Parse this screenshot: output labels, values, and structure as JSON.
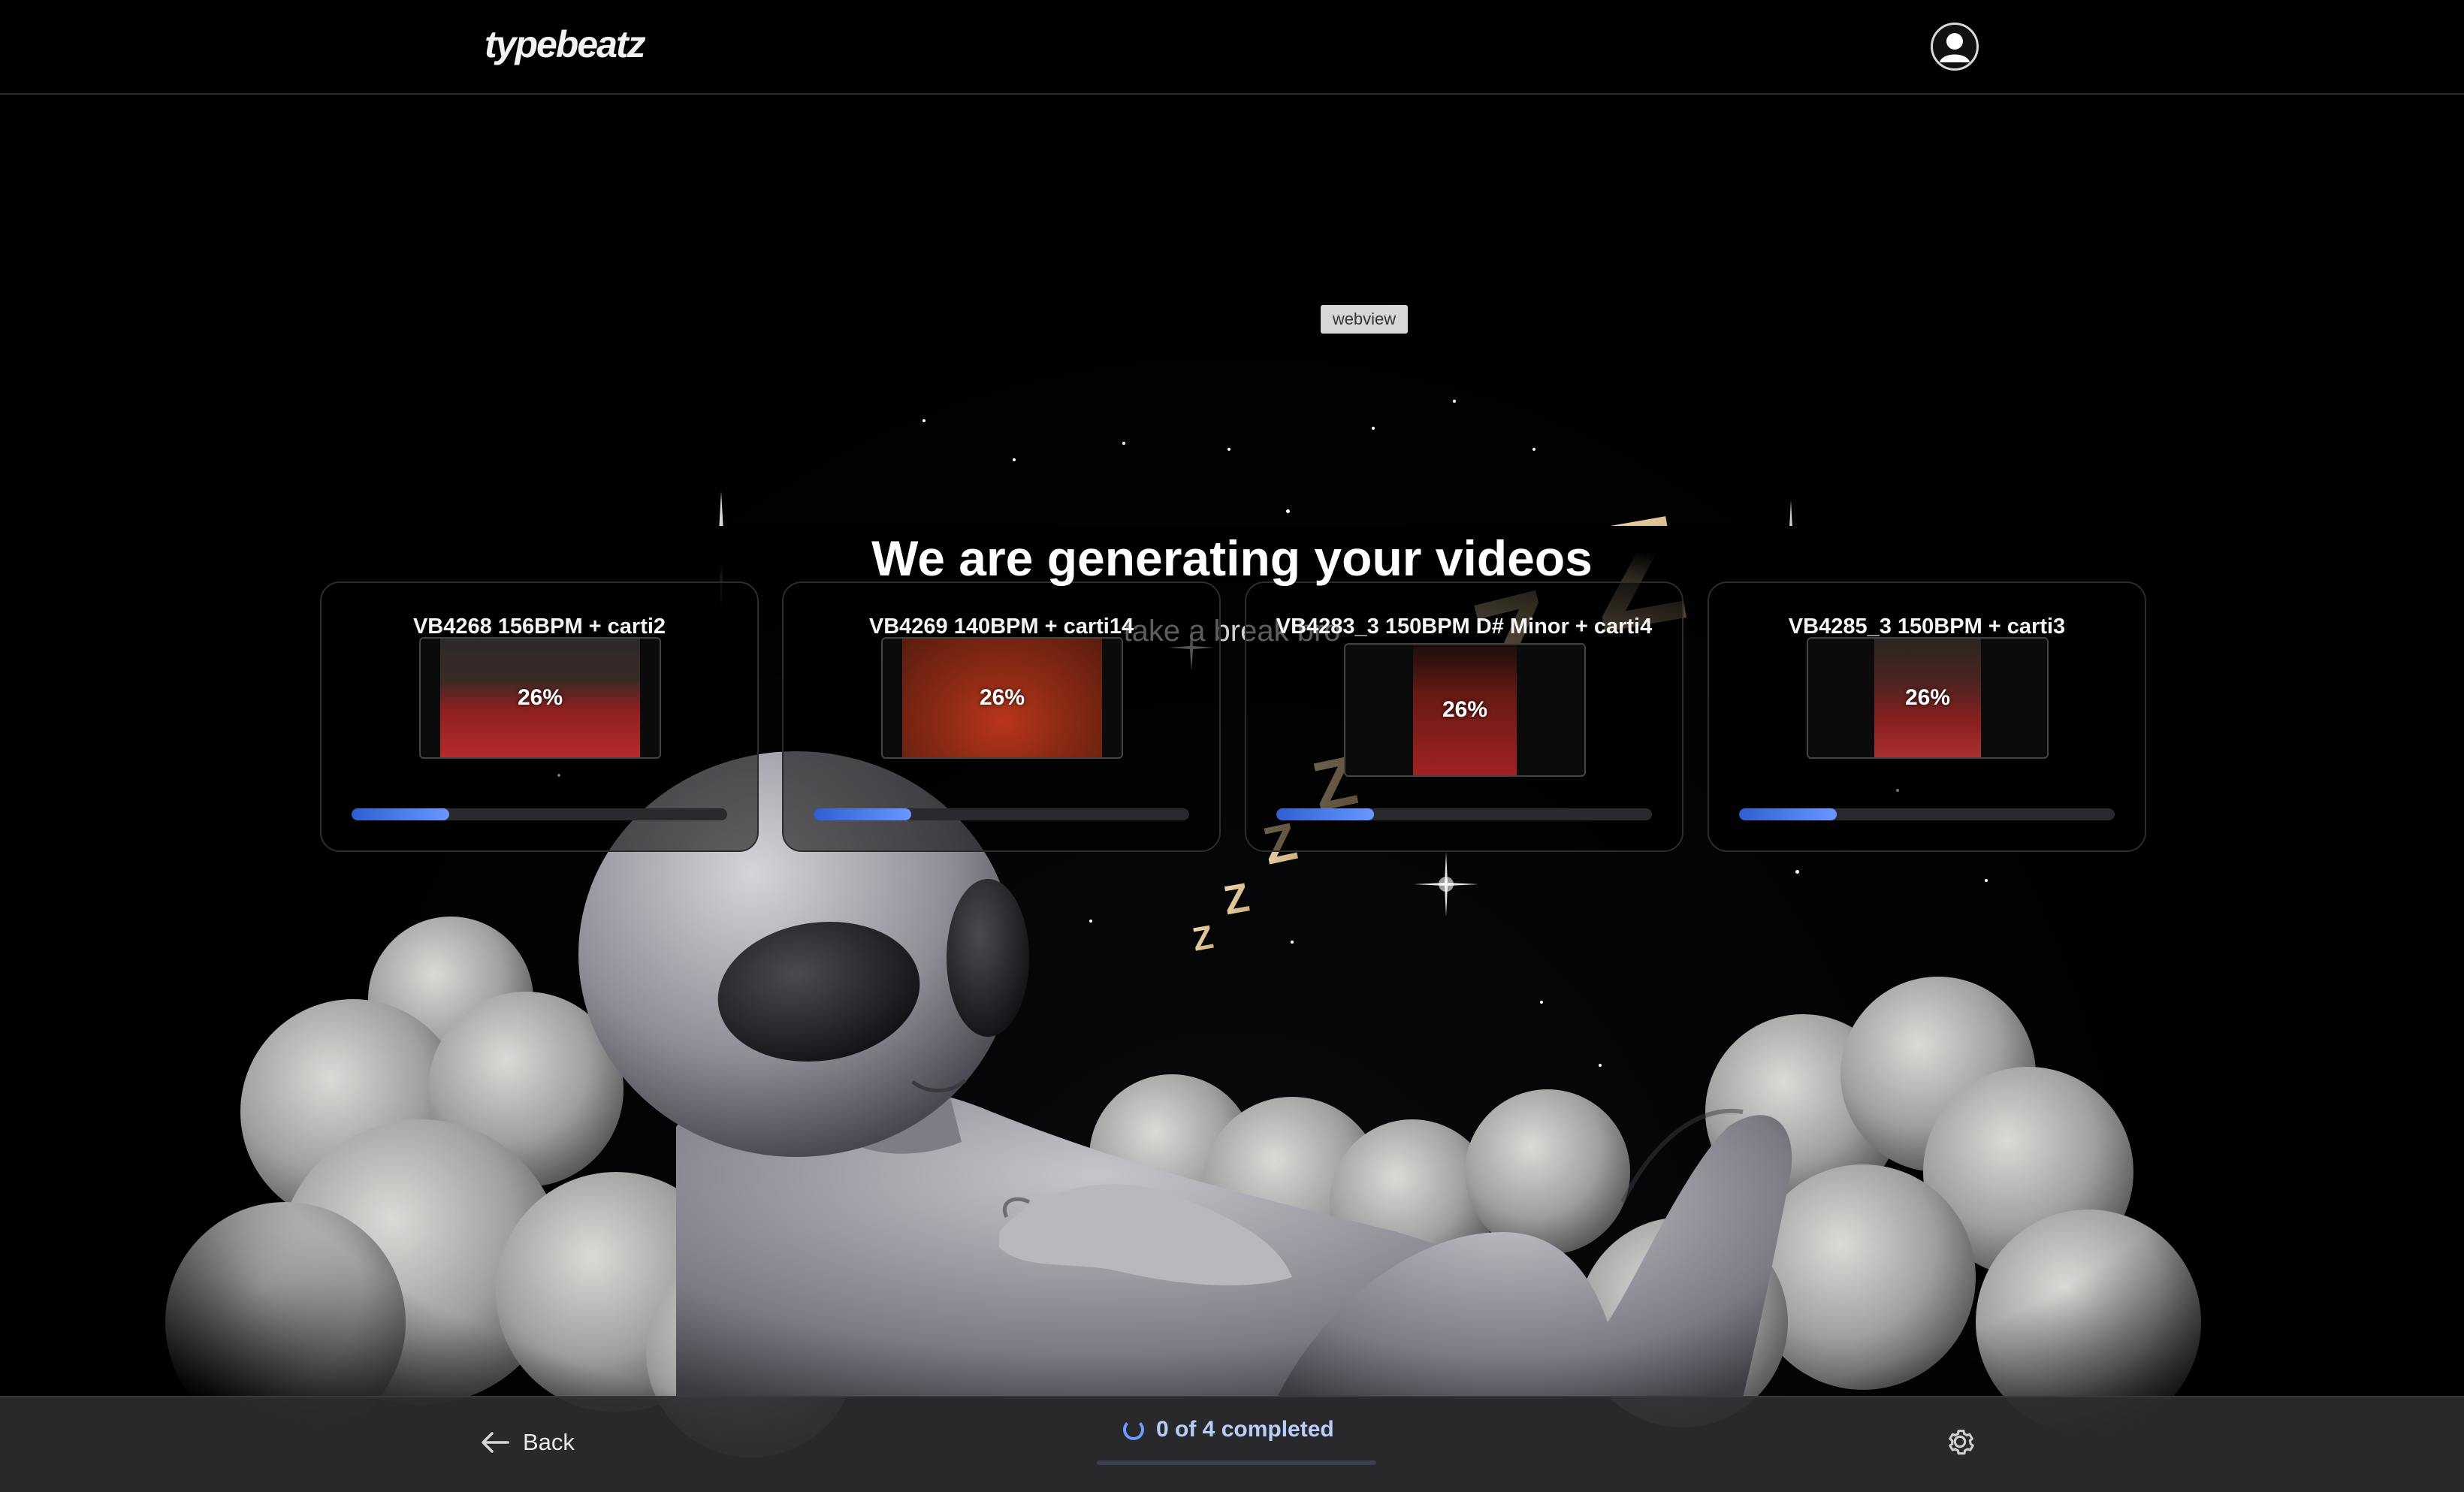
{
  "header": {
    "logo": "typebeatz",
    "avatar_icon": "user-avatar-icon"
  },
  "webview_label": "webview",
  "hero": {
    "title": "We are generating your videos",
    "subtitle": "take a break bro"
  },
  "cards": [
    {
      "title": "VB4268 156BPM + carti2",
      "progress_label": "26%",
      "progress": 0.26
    },
    {
      "title": "VB4269 140BPM + carti14",
      "progress_label": "26%",
      "progress": 0.26
    },
    {
      "title": "VB4283_3 150BPM D# Minor + carti4",
      "progress_label": "26%",
      "progress": 0.26
    },
    {
      "title": "VB4285_3 150BPM + carti3",
      "progress_label": "26%",
      "progress": 0.26
    }
  ],
  "footer": {
    "back_label": "Back",
    "status_label": "0 of 4 completed",
    "completed": 0,
    "total": 4,
    "settings_icon": "gear-icon"
  },
  "colors": {
    "accent": "#6f9bff",
    "progress_fill": "#3b6fe0",
    "background": "#000000"
  }
}
